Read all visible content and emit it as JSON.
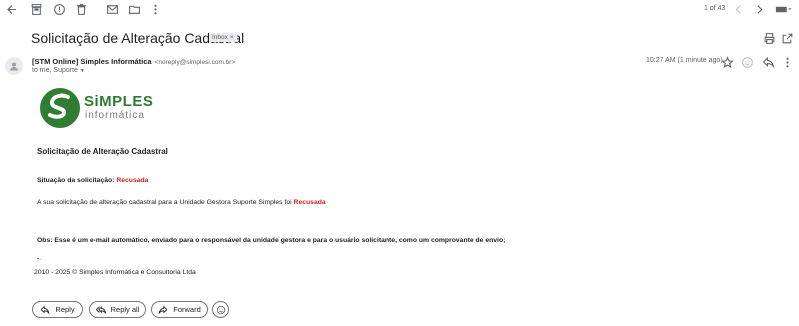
{
  "toolbar": {
    "pagination": "1 of 43",
    "icons": [
      "back-arrow-icon",
      "archive-icon",
      "report-spam-icon",
      "delete-icon",
      "mark-unread-icon",
      "move-to-icon",
      "more-vert-icon",
      "prev-icon",
      "next-icon",
      "keyboard-icon"
    ]
  },
  "email": {
    "subject": "Solicitação de Alteração Cadastral",
    "label": "Inbox",
    "label_close": "×",
    "sender_name": "[STM Online] Simples Informática",
    "sender_email": "<noreply@simplesi.com.br>",
    "recipients": "to me, Suporte",
    "timestamp": "10:27 AM (1 minute ago)"
  },
  "logo": {
    "name": "SiMPLES",
    "tagline": "informática",
    "colors": {
      "green": "#2e7d32",
      "grey": "#6d6d6d"
    }
  },
  "body": {
    "heading": "Solicitação de Alteração Cadastral",
    "status_label": "Situação da solicitação:",
    "status_value": "Recusada",
    "message": "A sua solicitação de alteração cadastral para a Unidade Gestora Suporte Simples foi",
    "message_status": "Recusada",
    "note": "Obs: Esse é um e-mail automático, enviado para o responsável da unidade gestora e para o usuário solicitante, como um comprovante de envio;",
    "sign": "-.",
    "footer": "2010 - 2025 © Simples Informática e Consultoria Ltda"
  },
  "actions": {
    "reply": "Reply",
    "reply_all": "Reply all",
    "forward": "Forward"
  },
  "colors": {
    "status_red": "#c5221f"
  }
}
